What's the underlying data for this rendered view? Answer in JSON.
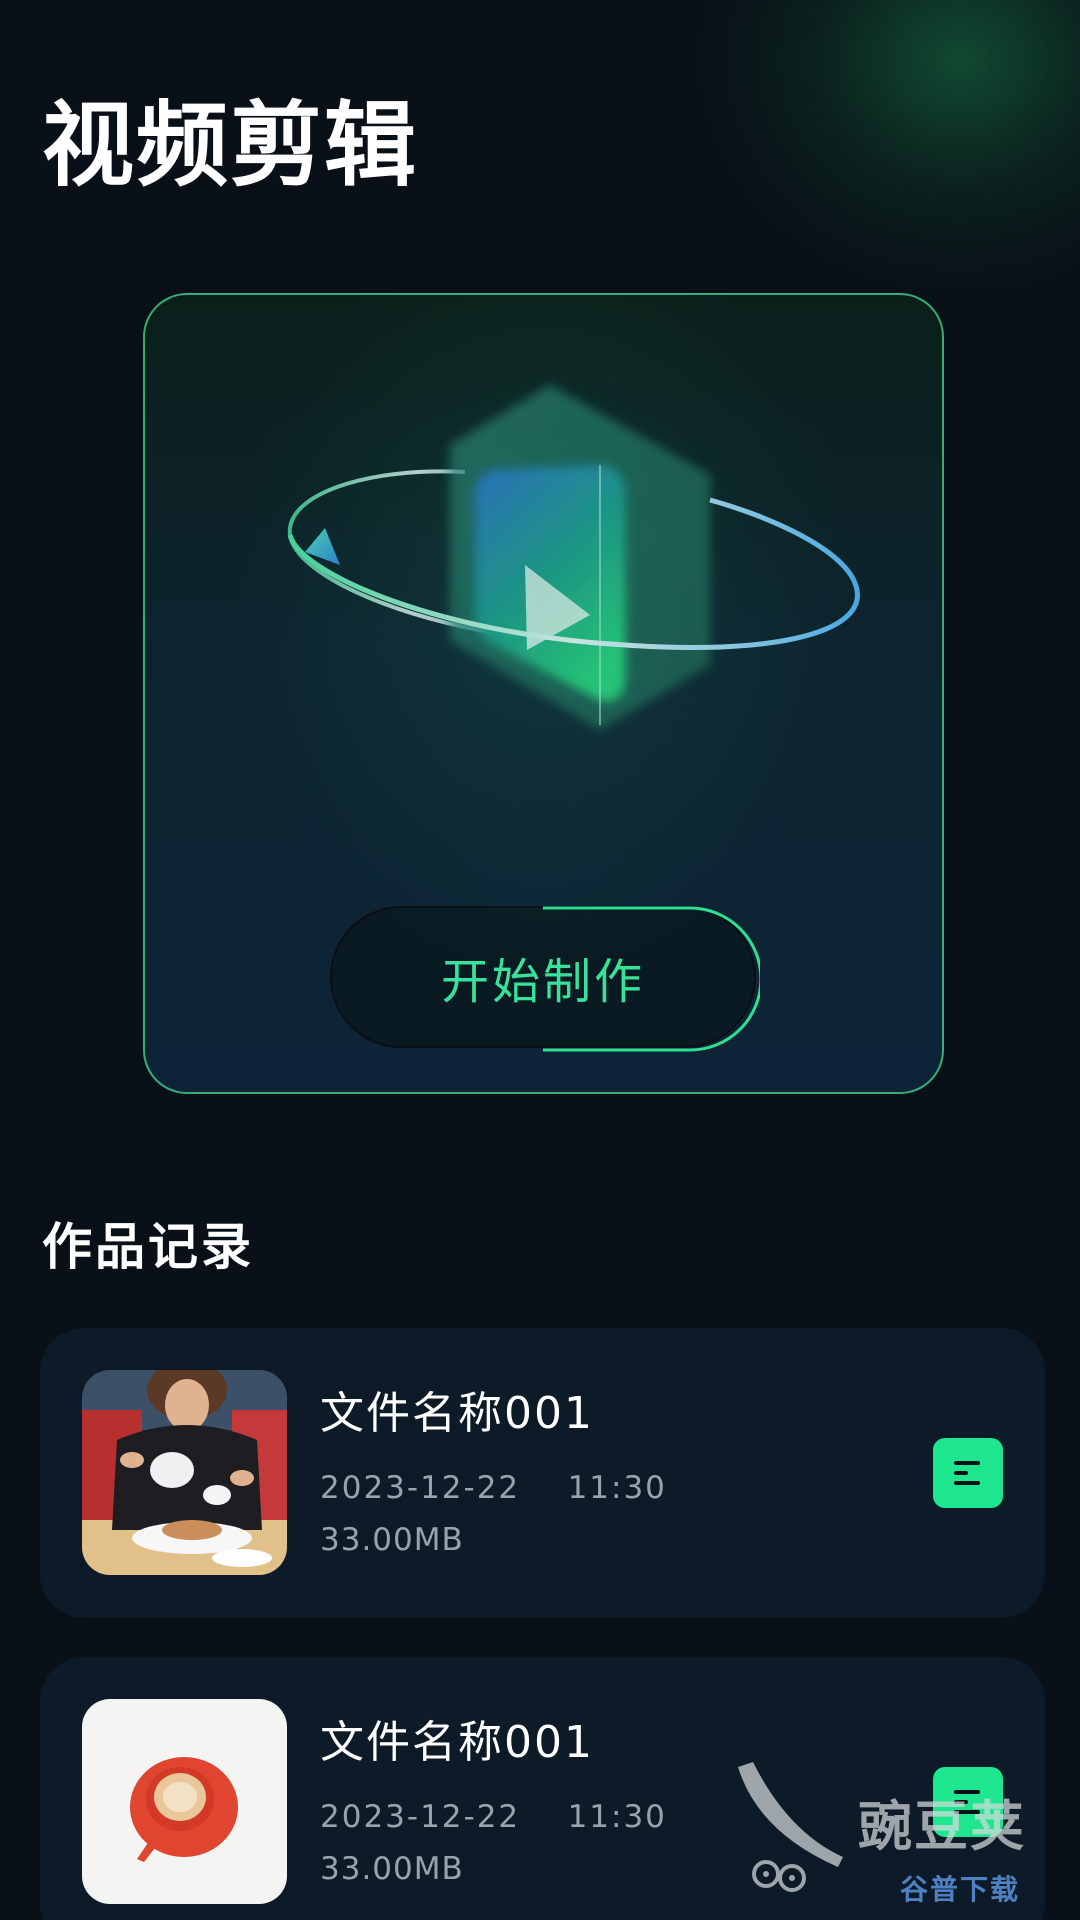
{
  "header": {
    "title": "视频剪辑"
  },
  "hero": {
    "illustration_icon": "video-cube-orbit-icon",
    "start_button_label": "开始制作"
  },
  "records": {
    "section_title": "作品记录",
    "items": [
      {
        "name": "文件名称001",
        "date": "2023-12-22    11:30",
        "size": "33.00MB",
        "thumbnail": "tea-pouring-photo",
        "action_icon": "menu-lines-icon"
      },
      {
        "name": "文件名称001",
        "date": "2023-12-22    11:30",
        "size": "33.00MB",
        "thumbnail": "coffee-cup-photo",
        "action_icon": "menu-lines-icon"
      }
    ]
  },
  "watermark": {
    "main_text": "豌豆荚",
    "sub_text": "谷普下载"
  },
  "colors": {
    "background": "#0a1017",
    "accent_green": "#1ee68f",
    "button_text_green": "#38e29a",
    "card_background": "#0c1b27",
    "secondary_text": "#9aa3ab"
  }
}
